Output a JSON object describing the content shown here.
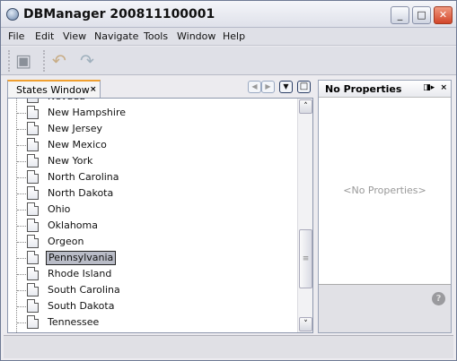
{
  "window": {
    "title": "DBManager 200811100001",
    "controls": {
      "minimize": "_",
      "maximize": "□",
      "close": "✕"
    }
  },
  "menu": [
    "File",
    "Edit",
    "View",
    "Navigate",
    "Tools",
    "Window",
    "Help"
  ],
  "toolbar": {
    "save_all": "save-all-icon",
    "undo": "undo-icon",
    "redo": "redo-icon"
  },
  "states_window": {
    "tab_label": "States Window",
    "tab_close": "×",
    "nav": {
      "left": "◀",
      "right": "▶",
      "menu": "▼",
      "maximize": "□"
    },
    "items": [
      "Nevada",
      "New Hampshire",
      "New Jersey",
      "New Mexico",
      "New York",
      "North Carolina",
      "North Dakota",
      "Ohio",
      "Oklahoma",
      "Orgeon",
      "Pennsylvania",
      "Rhode Island",
      "South Carolina",
      "South Dakota",
      "Tennessee"
    ],
    "selected": "Pennsylvania",
    "scroll_up": "˄",
    "scroll_down": "˅",
    "thumb_grip": "≡"
  },
  "properties": {
    "title": "No Properties",
    "empty_text": "<No Properties>",
    "pin": "◨▸",
    "close": "×",
    "help": "?"
  }
}
